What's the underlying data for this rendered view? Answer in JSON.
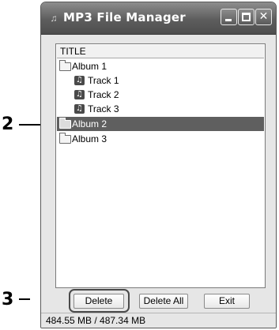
{
  "callouts": {
    "list_callout": "2",
    "button_callout": "3"
  },
  "window": {
    "title": "MP3 File Manager",
    "icons": {
      "app": "music-note-icon",
      "minimize": "minimize-icon",
      "maximize": "maximize-icon",
      "close": "close-icon"
    }
  },
  "list": {
    "column_header": "TITLE",
    "items": [
      {
        "type": "album",
        "label": "Album 1",
        "icon": "folder-icon",
        "selected": false
      },
      {
        "type": "track",
        "label": "Track 1",
        "icon": "track-icon",
        "selected": false
      },
      {
        "type": "track",
        "label": "Track 2",
        "icon": "track-icon",
        "selected": false
      },
      {
        "type": "track",
        "label": "Track 3",
        "icon": "track-icon",
        "selected": false
      },
      {
        "type": "album",
        "label": "Album 2",
        "icon": "open-folder-icon",
        "selected": true
      },
      {
        "type": "album",
        "label": "Album 3",
        "icon": "folder-icon",
        "selected": false
      }
    ]
  },
  "buttons": {
    "delete": "Delete",
    "delete_all": "Delete All",
    "exit": "Exit"
  },
  "status": {
    "storage": "484.55 MB / 487.34 MB"
  },
  "colors": {
    "titlebar": "#5d5d5d",
    "selected_row": "#5f5f5f",
    "window_bg": "#e6e6e6"
  }
}
